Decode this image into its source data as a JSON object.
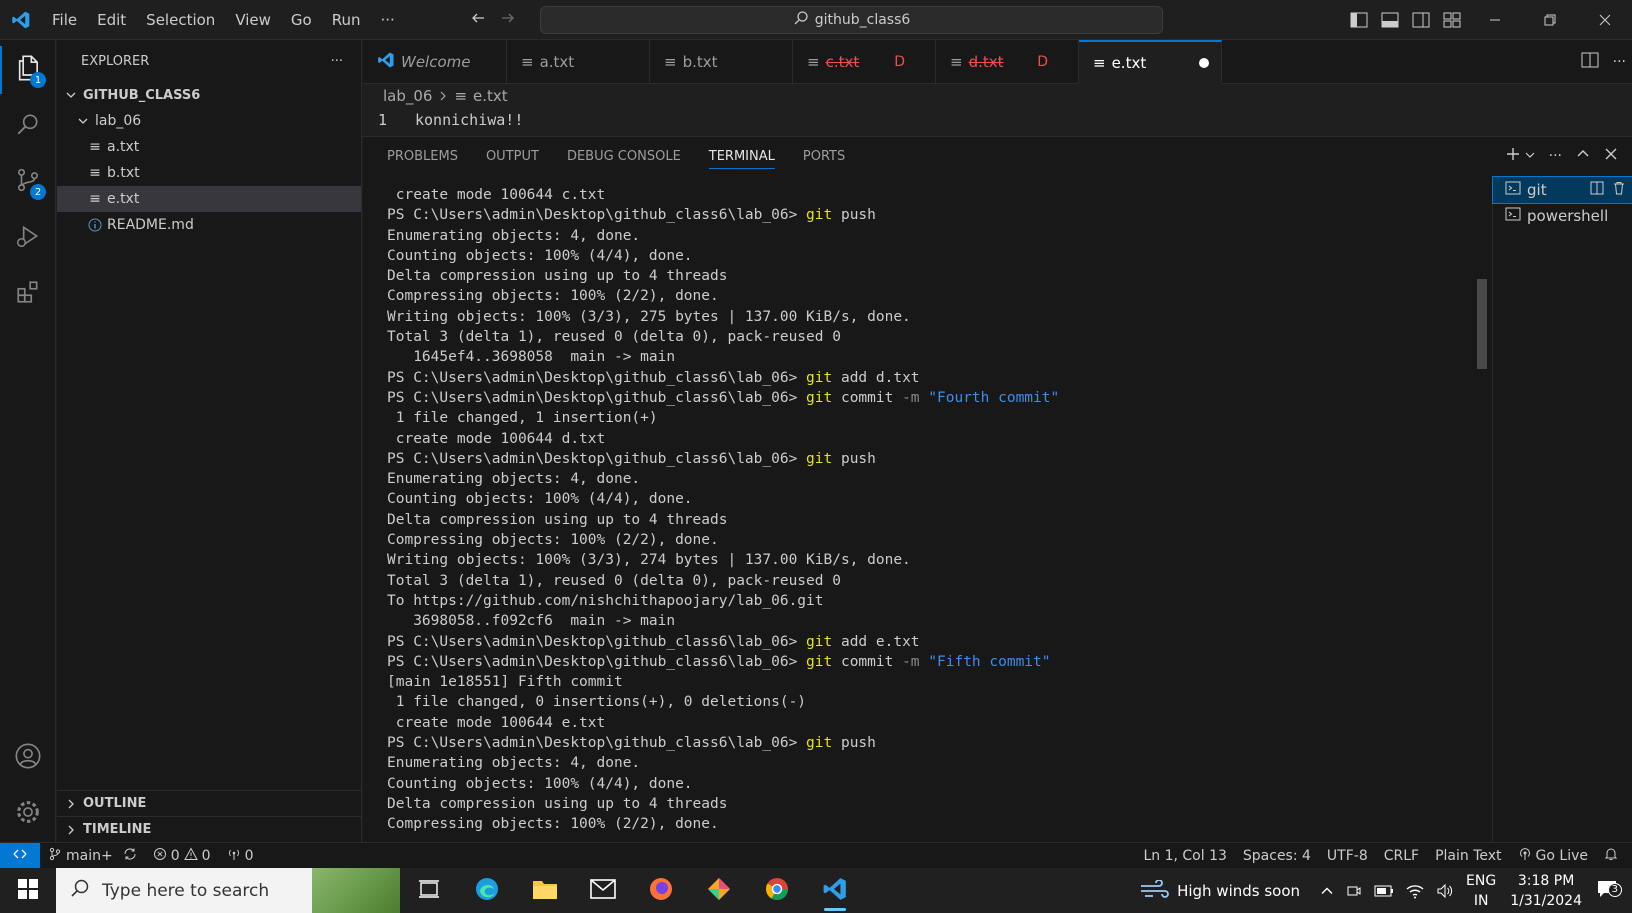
{
  "titlebar": {
    "menus": [
      "File",
      "Edit",
      "Selection",
      "View",
      "Go",
      "Run",
      "···"
    ],
    "search_text": "github_class6"
  },
  "activity": {
    "explorer_badge": "1",
    "scm_badge": "2"
  },
  "explorer": {
    "title": "EXPLORER",
    "more": "···",
    "root": "GITHUB_CLASS6",
    "folder": "lab_06",
    "files": [
      "a.txt",
      "b.txt",
      "e.txt"
    ],
    "readme": "README.md",
    "outline": "OUTLINE",
    "timeline": "TIMELINE"
  },
  "tabs": [
    {
      "label": "Welcome"
    },
    {
      "label": "a.txt"
    },
    {
      "label": "b.txt"
    },
    {
      "label": "c.txt",
      "deco": "D"
    },
    {
      "label": "d.txt",
      "deco": "D"
    },
    {
      "label": "e.txt"
    }
  ],
  "breadcrumb": {
    "folder": "lab_06",
    "file": "e.txt"
  },
  "editor": {
    "line_number": "1",
    "line_text": "konnichiwa!!"
  },
  "panel": {
    "tabs": [
      "PROBLEMS",
      "OUTPUT",
      "DEBUG CONSOLE",
      "TERMINAL",
      "PORTS"
    ],
    "terminals": [
      "git",
      "powershell"
    ]
  },
  "terminal_lines": [
    [
      {
        "t": " create mode 100644 c.txt"
      }
    ],
    [
      {
        "t": "PS C:\\Users\\admin\\Desktop\\github_class6\\lab_06> "
      },
      {
        "t": "git",
        "c": "cmd"
      },
      {
        "t": " push"
      }
    ],
    [
      {
        "t": "Enumerating objects: 4, done."
      }
    ],
    [
      {
        "t": "Counting objects: 100% (4/4), done."
      }
    ],
    [
      {
        "t": "Delta compression using up to 4 threads"
      }
    ],
    [
      {
        "t": "Compressing objects: 100% (2/2), done."
      }
    ],
    [
      {
        "t": "Writing objects: 100% (3/3), 275 bytes | 137.00 KiB/s, done."
      }
    ],
    [
      {
        "t": "Total 3 (delta 1), reused 0 (delta 0), pack-reused 0"
      }
    ],
    [
      {
        "t": "   1645ef4..3698058  main -> main"
      }
    ],
    [
      {
        "t": "PS C:\\Users\\admin\\Desktop\\github_class6\\lab_06> "
      },
      {
        "t": "git",
        "c": "cmd"
      },
      {
        "t": " add d.txt"
      }
    ],
    [
      {
        "t": "PS C:\\Users\\admin\\Desktop\\github_class6\\lab_06> "
      },
      {
        "t": "git",
        "c": "cmd"
      },
      {
        "t": " commit "
      },
      {
        "t": "-m",
        "c": "flag"
      },
      {
        "t": " "
      },
      {
        "t": "\"Fourth commit\"",
        "c": "str"
      }
    ],
    [
      {
        "t": " 1 file changed, 1 insertion(+)"
      }
    ],
    [
      {
        "t": " create mode 100644 d.txt"
      }
    ],
    [
      {
        "t": "PS C:\\Users\\admin\\Desktop\\github_class6\\lab_06> "
      },
      {
        "t": "git",
        "c": "cmd"
      },
      {
        "t": " push"
      }
    ],
    [
      {
        "t": "Enumerating objects: 4, done."
      }
    ],
    [
      {
        "t": "Counting objects: 100% (4/4), done."
      }
    ],
    [
      {
        "t": "Delta compression using up to 4 threads"
      }
    ],
    [
      {
        "t": "Compressing objects: 100% (2/2), done."
      }
    ],
    [
      {
        "t": "Writing objects: 100% (3/3), 274 bytes | 137.00 KiB/s, done."
      }
    ],
    [
      {
        "t": "Total 3 (delta 1), reused 0 (delta 0), pack-reused 0"
      }
    ],
    [
      {
        "t": "To https://github.com/nishchithapoojary/lab_06.git"
      }
    ],
    [
      {
        "t": "   3698058..f092cf6  main -> main"
      }
    ],
    [
      {
        "t": "PS C:\\Users\\admin\\Desktop\\github_class6\\lab_06> "
      },
      {
        "t": "git",
        "c": "cmd"
      },
      {
        "t": " add e.txt"
      }
    ],
    [
      {
        "t": "PS C:\\Users\\admin\\Desktop\\github_class6\\lab_06> "
      },
      {
        "t": "git",
        "c": "cmd"
      },
      {
        "t": " commit "
      },
      {
        "t": "-m",
        "c": "flag"
      },
      {
        "t": " "
      },
      {
        "t": "\"Fifth commit\"",
        "c": "str"
      }
    ],
    [
      {
        "t": "[main 1e18551] Fifth commit"
      }
    ],
    [
      {
        "t": " 1 file changed, 0 insertions(+), 0 deletions(-)"
      }
    ],
    [
      {
        "t": " create mode 100644 e.txt"
      }
    ],
    [
      {
        "t": "PS C:\\Users\\admin\\Desktop\\github_class6\\lab_06> "
      },
      {
        "t": "git",
        "c": "cmd"
      },
      {
        "t": " push"
      }
    ],
    [
      {
        "t": "Enumerating objects: 4, done."
      }
    ],
    [
      {
        "t": "Counting objects: 100% (4/4), done."
      }
    ],
    [
      {
        "t": "Delta compression using up to 4 threads"
      }
    ],
    [
      {
        "t": "Compressing objects: 100% (2/2), done."
      }
    ]
  ],
  "statusbar": {
    "branch": "main+",
    "errors": "0",
    "warnings": "0",
    "ports": "0",
    "position": "Ln 1, Col 13",
    "spaces": "Spaces: 4",
    "encoding": "UTF-8",
    "eol": "CRLF",
    "language": "Plain Text",
    "golive": "Go Live"
  },
  "taskbar": {
    "search_placeholder": "Type here to search",
    "weather": "High winds soon",
    "lang1": "ENG",
    "lang2": "IN",
    "time": "3:18 PM",
    "date": "1/31/2024",
    "notif_count": "3"
  },
  "colors": {
    "accent": "#0078d4",
    "deleted": "#f14c4c",
    "command": "#e5e510",
    "string": "#3b8eea"
  }
}
